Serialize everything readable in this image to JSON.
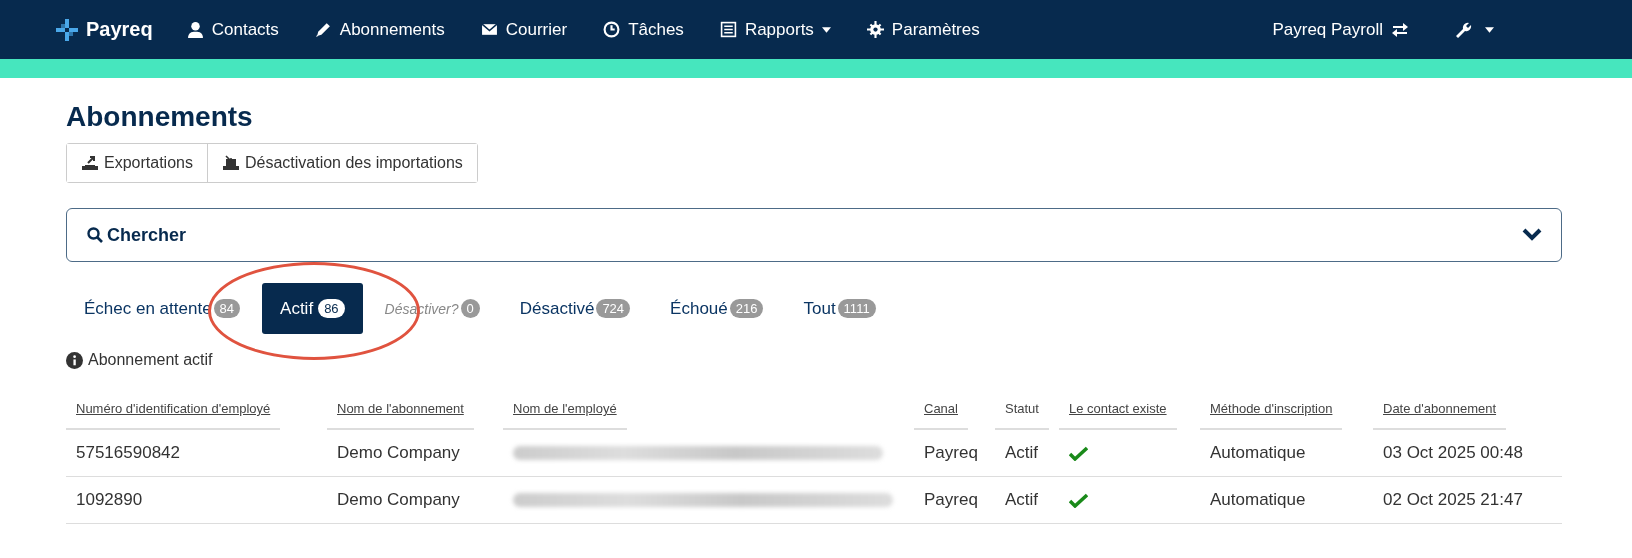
{
  "navbar": {
    "brand": "Payreq",
    "items": [
      {
        "label": "Contacts",
        "dropdown": false
      },
      {
        "label": "Abonnements",
        "dropdown": false
      },
      {
        "label": "Courrier",
        "dropdown": false
      },
      {
        "label": "Tâches",
        "dropdown": false
      },
      {
        "label": "Rapports",
        "dropdown": true
      },
      {
        "label": "Paramètres",
        "dropdown": false
      }
    ],
    "account": "Payreq Payroll"
  },
  "page_title": "Abonnements",
  "toolbar": [
    {
      "label": "Exportations"
    },
    {
      "label": "Désactivation des importations"
    }
  ],
  "search": {
    "label": "Chercher",
    "expanded": false
  },
  "tabs": [
    {
      "label": "Échec en attente",
      "count": "84",
      "selected": false,
      "disabled": false
    },
    {
      "label": "Actif",
      "count": "86",
      "selected": true,
      "disabled": false
    },
    {
      "label": "Désactiver?",
      "count": "0",
      "selected": false,
      "disabled": true
    },
    {
      "label": "Désactivé",
      "count": "724",
      "selected": false,
      "disabled": false
    },
    {
      "label": "Échoué",
      "count": "216",
      "selected": false,
      "disabled": false
    },
    {
      "label": "Tout",
      "count": "1111",
      "selected": false,
      "disabled": false
    }
  ],
  "annotation": {
    "kind": "ellipse",
    "color": "#e0533f"
  },
  "info": "Abonnement actif",
  "table": {
    "columns": [
      {
        "label": "Numéro d'identification d'employé",
        "sortable": true
      },
      {
        "label": "Nom de l'abonnement",
        "sortable": true
      },
      {
        "label": "Nom de l'employé",
        "sortable": true
      },
      {
        "label": "Canal",
        "sortable": true
      },
      {
        "label": "Statut",
        "sortable": false
      },
      {
        "label": "Le contact existe",
        "sortable": true
      },
      {
        "label": "Méthode d'inscription",
        "sortable": true
      },
      {
        "label": "Date d'abonnement",
        "sortable": true
      }
    ],
    "rows": [
      {
        "employee_id": "57516590842",
        "subscription": "Demo Company",
        "employee_name_redacted": true,
        "channel": "Payreq",
        "status": "Actif",
        "contact_exists": true,
        "method": "Automatique",
        "date": "03 Oct 2025 00:48"
      },
      {
        "employee_id": "1092890",
        "subscription": "Demo Company",
        "employee_name_redacted": true,
        "channel": "Payreq",
        "status": "Actif",
        "contact_exists": true,
        "method": "Automatique",
        "date": "02 Oct 2025 21:47"
      }
    ]
  }
}
